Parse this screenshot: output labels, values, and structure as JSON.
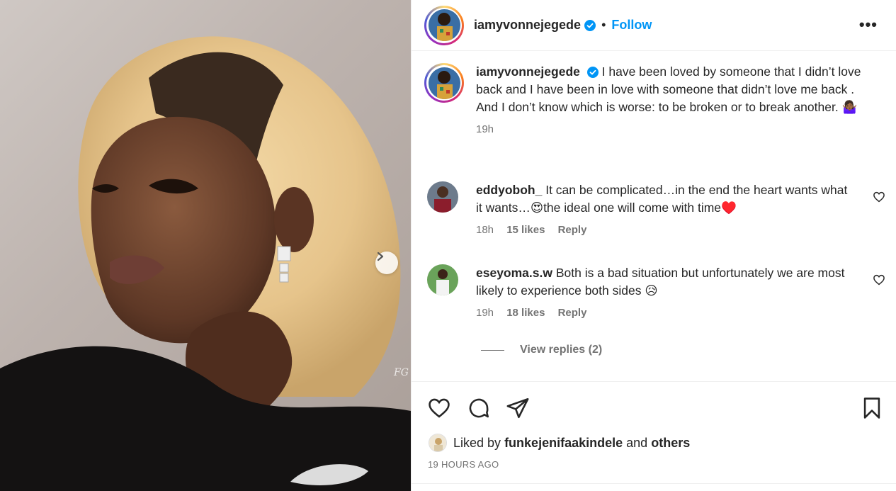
{
  "post": {
    "username": "iamyvonnejegede",
    "dot": "•",
    "follow_label": "Follow",
    "more_label": "•••",
    "watermark": "FG"
  },
  "caption": {
    "username": "iamyvonnejegede",
    "text": "I have been loved by someone that I didn’t love back and I have been in love with someone that didn’t love me back . And I don’t know which is worse: to be broken or to break another. 🤷🏾‍♀️",
    "time": "19h"
  },
  "comments": [
    {
      "username": "eddyoboh_",
      "text": "It can be complicated…in the end the heart wants what it wants…😍the ideal one will come with time♥️",
      "time": "18h",
      "likes": "15 likes",
      "reply": "Reply"
    },
    {
      "username": "eseyoma.s.w",
      "text": "Both is a bad situation but unfortunately we are most likely to experience both sides 😥",
      "time": "19h",
      "likes": "18 likes",
      "reply": "Reply"
    }
  ],
  "view_replies": "View replies (2)",
  "likes_line": {
    "prefix": "Liked by",
    "user": "funkejenifaakindele",
    "middle": "and",
    "others": "others"
  },
  "time_ago": "19 HOURS AGO",
  "colors": {
    "link_blue": "#0095f6",
    "verified_blue": "#0095f6",
    "text_primary": "#262626",
    "text_secondary": "#737373",
    "divider": "#efefef"
  },
  "icons": [
    "verified-badge-icon",
    "more-options-icon",
    "chevron-right-icon",
    "heart-icon",
    "comment-icon",
    "share-icon",
    "bookmark-icon"
  ]
}
